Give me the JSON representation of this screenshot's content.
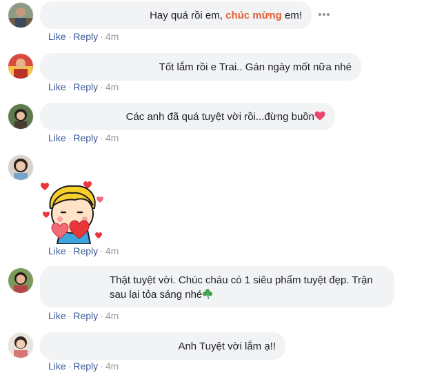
{
  "comments": [
    {
      "text_before": "Hay quá rồi em, ",
      "highlight": "chúc mừng",
      "text_after": " em!",
      "like": "Like",
      "reply": "Reply",
      "time": "4m"
    },
    {
      "text": "Tốt lắm rồi e Trai.. Gán ngày mốt nữa nhé",
      "like": "Like",
      "reply": "Reply",
      "time": "4m"
    },
    {
      "text": "Các anh đã quá tuyệt vời rồi...đừng buồn",
      "emoji": "heart-icon",
      "like": "Like",
      "reply": "Reply",
      "time": "4m"
    },
    {
      "sticker": "boy-with-hearts-sticker",
      "like": "Like",
      "reply": "Reply",
      "time": "4m"
    },
    {
      "line1": "Thật tuyệt vời. Chúc cháu có 1 siêu phẩm tuyệt đẹp. Trận",
      "line2": "sau lại tỏa sáng nhé",
      "emoji": "clover-icon",
      "like": "Like",
      "reply": "Reply",
      "time": "4m"
    },
    {
      "text": "Anh Tuyệt vời lắm ạ!!",
      "like": "Like",
      "reply": "Reply",
      "time": "4m"
    }
  ],
  "separator": "·",
  "colors": {
    "bubble": "#f2f3f5",
    "link": "#385898",
    "meta": "#999999",
    "highlight": "#e06035",
    "heart": "#e8466a",
    "clover": "#3fa34d"
  }
}
